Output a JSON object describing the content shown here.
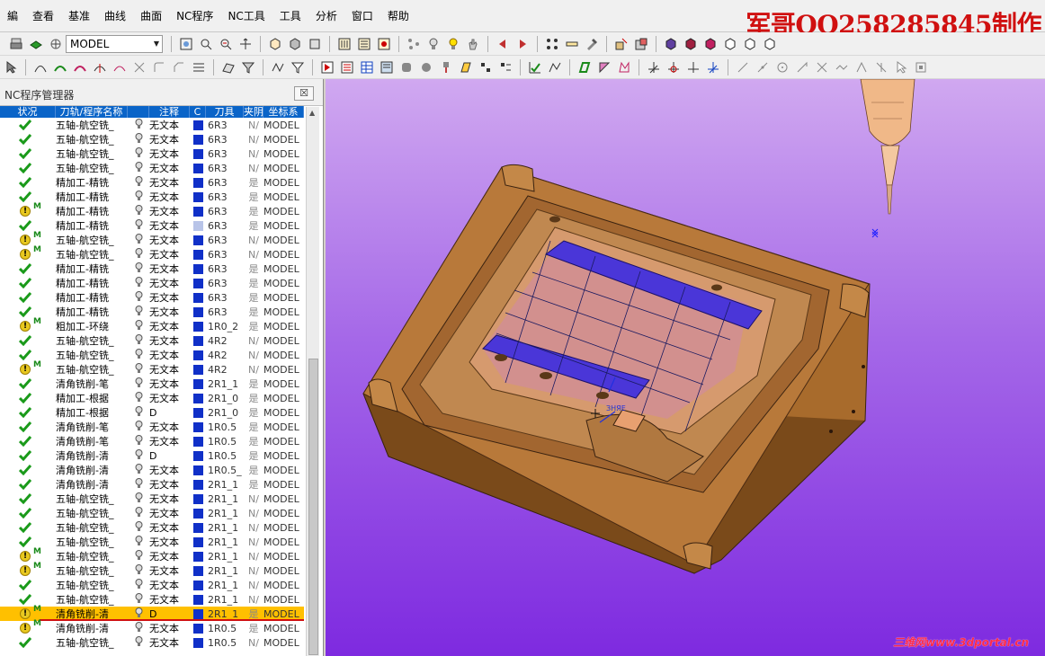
{
  "menu": [
    "編",
    "查看",
    "基准",
    "曲线",
    "曲面",
    "NC程序",
    "NC工具",
    "工具",
    "分析",
    "窗口",
    "帮助"
  ],
  "watermark_top": "军哥QQ258285845制作",
  "watermark_bottom": "三维网www.3dportal.cn",
  "toolbar": {
    "model_combo": "MODEL"
  },
  "panel": {
    "title": "NC程序管理器",
    "close_label": "☒",
    "columns": [
      "状况",
      "刀轨/程序名称",
      "",
      "注释",
      "C",
      "刀具",
      "夹阴",
      "坐标系"
    ]
  },
  "rows": [
    {
      "status": "ok",
      "m": "",
      "name": "五轴-航空铣_",
      "note": "无文本",
      "c": "dark",
      "tool": "6R3",
      "clip": "N/",
      "coord": "MODEL"
    },
    {
      "status": "ok",
      "m": "",
      "name": "五轴-航空铣_",
      "note": "无文本",
      "c": "dark",
      "tool": "6R3",
      "clip": "N/",
      "coord": "MODEL"
    },
    {
      "status": "ok",
      "m": "",
      "name": "五轴-航空铣_",
      "note": "无文本",
      "c": "dark",
      "tool": "6R3",
      "clip": "N/",
      "coord": "MODEL"
    },
    {
      "status": "ok",
      "m": "",
      "name": "五轴-航空铣_",
      "note": "无文本",
      "c": "dark",
      "tool": "6R3",
      "clip": "N/",
      "coord": "MODEL"
    },
    {
      "status": "ok",
      "m": "",
      "name": "精加工-精铣",
      "note": "无文本",
      "c": "dark",
      "tool": "6R3",
      "clip": "是",
      "coord": "MODEL"
    },
    {
      "status": "ok",
      "m": "",
      "name": "精加工-精铣",
      "note": "无文本",
      "c": "dark",
      "tool": "6R3",
      "clip": "是",
      "coord": "MODEL"
    },
    {
      "status": "warn",
      "m": "M",
      "name": "精加工-精铣",
      "note": "无文本",
      "c": "dark",
      "tool": "6R3",
      "clip": "是",
      "coord": "MODEL"
    },
    {
      "status": "ok",
      "m": "",
      "name": "精加工-精铣",
      "note": "无文本",
      "c": "light",
      "tool": "6R3",
      "clip": "是",
      "coord": "MODEL"
    },
    {
      "status": "warn",
      "m": "M",
      "name": "五轴-航空铣_",
      "note": "无文本",
      "c": "dark",
      "tool": "6R3",
      "clip": "N/",
      "coord": "MODEL"
    },
    {
      "status": "warn",
      "m": "M",
      "name": "五轴-航空铣_",
      "note": "无文本",
      "c": "dark",
      "tool": "6R3",
      "clip": "N/",
      "coord": "MODEL"
    },
    {
      "status": "ok",
      "m": "",
      "name": "精加工-精铣",
      "note": "无文本",
      "c": "dark",
      "tool": "6R3",
      "clip": "是",
      "coord": "MODEL"
    },
    {
      "status": "ok",
      "m": "",
      "name": "精加工-精铣",
      "note": "无文本",
      "c": "dark",
      "tool": "6R3",
      "clip": "是",
      "coord": "MODEL"
    },
    {
      "status": "ok",
      "m": "",
      "name": "精加工-精铣",
      "note": "无文本",
      "c": "dark",
      "tool": "6R3",
      "clip": "是",
      "coord": "MODEL"
    },
    {
      "status": "ok",
      "m": "",
      "name": "精加工-精铣",
      "note": "无文本",
      "c": "dark",
      "tool": "6R3",
      "clip": "是",
      "coord": "MODEL"
    },
    {
      "status": "warn",
      "m": "M",
      "name": "粗加工-环绕",
      "note": "无文本",
      "c": "dark",
      "tool": "1R0_2",
      "clip": "是",
      "coord": "MODEL"
    },
    {
      "status": "ok",
      "m": "",
      "name": "五轴-航空铣_",
      "note": "无文本",
      "c": "dark",
      "tool": "4R2",
      "clip": "N/",
      "coord": "MODEL"
    },
    {
      "status": "ok",
      "m": "",
      "name": "五轴-航空铣_",
      "note": "无文本",
      "c": "dark",
      "tool": "4R2",
      "clip": "N/",
      "coord": "MODEL"
    },
    {
      "status": "warn",
      "m": "M",
      "name": "五轴-航空铣_",
      "note": "无文本",
      "c": "dark",
      "tool": "4R2",
      "clip": "N/",
      "coord": "MODEL"
    },
    {
      "status": "ok",
      "m": "",
      "name": "清角铣削-笔",
      "note": "无文本",
      "c": "dark",
      "tool": "2R1_1",
      "clip": "是",
      "coord": "MODEL"
    },
    {
      "status": "ok",
      "m": "",
      "name": "精加工-根据",
      "note": "无文本",
      "c": "dark",
      "tool": "2R1_0",
      "clip": "是",
      "coord": "MODEL"
    },
    {
      "status": "ok",
      "m": "",
      "name": "精加工-根据",
      "note": "D",
      "c": "dark",
      "tool": "2R1_0",
      "clip": "是",
      "coord": "MODEL"
    },
    {
      "status": "ok",
      "m": "",
      "name": "清角铣削-笔",
      "note": "无文本",
      "c": "dark",
      "tool": "1R0.5",
      "clip": "是",
      "coord": "MODEL"
    },
    {
      "status": "ok",
      "m": "",
      "name": "清角铣削-笔",
      "note": "无文本",
      "c": "dark",
      "tool": "1R0.5",
      "clip": "是",
      "coord": "MODEL"
    },
    {
      "status": "ok",
      "m": "",
      "name": "清角铣削-清",
      "note": "D",
      "c": "dark",
      "tool": "1R0.5",
      "clip": "是",
      "coord": "MODEL"
    },
    {
      "status": "ok",
      "m": "",
      "name": "清角铣削-清",
      "note": "无文本",
      "c": "dark",
      "tool": "1R0.5_",
      "clip": "是",
      "coord": "MODEL"
    },
    {
      "status": "ok",
      "m": "",
      "name": "清角铣削-清",
      "note": "无文本",
      "c": "dark",
      "tool": "2R1_1",
      "clip": "是",
      "coord": "MODEL"
    },
    {
      "status": "ok",
      "m": "",
      "name": "五轴-航空铣_",
      "note": "无文本",
      "c": "dark",
      "tool": "2R1_1",
      "clip": "N/",
      "coord": "MODEL"
    },
    {
      "status": "ok",
      "m": "",
      "name": "五轴-航空铣_",
      "note": "无文本",
      "c": "dark",
      "tool": "2R1_1",
      "clip": "N/",
      "coord": "MODEL"
    },
    {
      "status": "ok",
      "m": "",
      "name": "五轴-航空铣_",
      "note": "无文本",
      "c": "dark",
      "tool": "2R1_1",
      "clip": "N/",
      "coord": "MODEL"
    },
    {
      "status": "ok",
      "m": "",
      "name": "五轴-航空铣_",
      "note": "无文本",
      "c": "dark",
      "tool": "2R1_1",
      "clip": "N/",
      "coord": "MODEL"
    },
    {
      "status": "warn",
      "m": "M",
      "name": "五轴-航空铣_",
      "note": "无文本",
      "c": "dark",
      "tool": "2R1_1",
      "clip": "N/",
      "coord": "MODEL"
    },
    {
      "status": "warn",
      "m": "M",
      "name": "五轴-航空铣_",
      "note": "无文本",
      "c": "dark",
      "tool": "2R1_1",
      "clip": "N/",
      "coord": "MODEL"
    },
    {
      "status": "ok",
      "m": "",
      "name": "五轴-航空铣_",
      "note": "无文本",
      "c": "dark",
      "tool": "2R1_1",
      "clip": "N/",
      "coord": "MODEL"
    },
    {
      "status": "ok",
      "m": "",
      "name": "五轴-航空铣_",
      "note": "无文本",
      "c": "dark",
      "tool": "2R1_1",
      "clip": "N/",
      "coord": "MODEL"
    },
    {
      "status": "warn",
      "m": "M",
      "name": "清角铣削-清",
      "note": "D",
      "c": "dark",
      "tool": "2R1_1",
      "clip": "是",
      "coord": "MODEL",
      "selected": true
    },
    {
      "status": "warn",
      "m": "M",
      "name": "清角铣削-清",
      "note": "无文本",
      "c": "dark",
      "tool": "1R0.5",
      "clip": "是",
      "coord": "MODEL"
    },
    {
      "status": "ok",
      "m": "",
      "name": "五轴-航空铣_",
      "note": "无文本",
      "c": "dark",
      "tool": "1R0.5",
      "clip": "N/",
      "coord": "MODEL"
    }
  ],
  "viewport": {
    "label_near_slot": "ЗНЯЕ"
  }
}
